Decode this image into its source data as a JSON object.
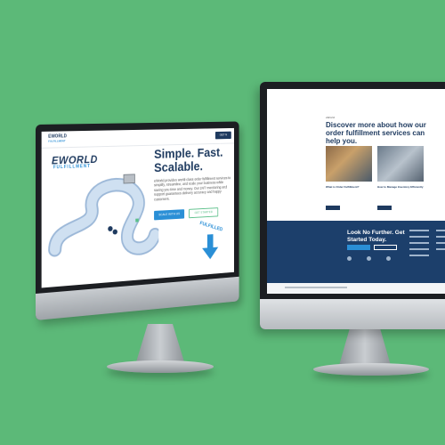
{
  "scene": {
    "background_color": "#5cb978",
    "accent_navy": "#1e3a5f",
    "accent_blue": "#2a8fd6",
    "accent_green": "#5cc08a"
  },
  "left_screen": {
    "logo_text": "EWORLD",
    "logo_sub": "FULFILLMENT",
    "nav_links": [
      "",
      "",
      "",
      ""
    ],
    "login": "",
    "nav_cta": "GET A QUOTE",
    "brand": "EWORLD",
    "brand_sub": "FULFILLMENT",
    "headline": "Simple. Fast. Scalable.",
    "body": "eWorld provides world-class order fulfillment services to simplify, streamline, and scale your business while saving you time and money. Our 24/7 monitoring and support guarantees delivery accuracy and happy customers.",
    "button_primary": "SCALE WITH US",
    "button_secondary": "GET STARTED",
    "fulfilled_label": "FULFILLED"
  },
  "right_screen": {
    "kicker": "eWorld",
    "headline": "Discover more about how our order fulfillment services can help you.",
    "card1_caption": "What is Order Fulfillment?",
    "card2_caption": "How to Manage Inventory Efficiently",
    "footer_title": "Look No Further. Get Started Today."
  }
}
